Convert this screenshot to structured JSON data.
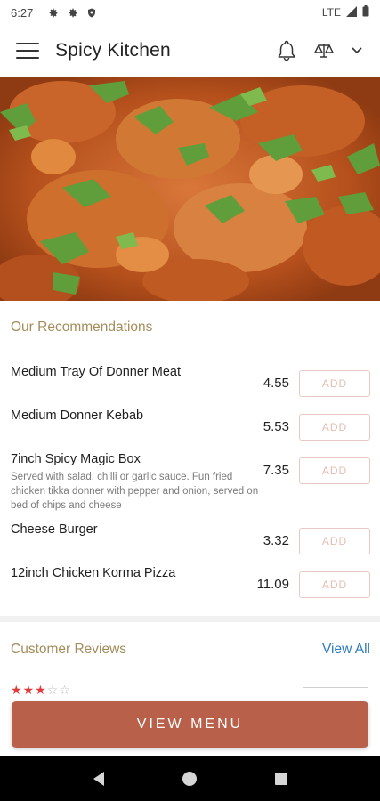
{
  "status_bar": {
    "time": "6:27",
    "network": "LTE",
    "left_icons": [
      "settings-icon",
      "settings-icon",
      "shield-icon"
    ],
    "right_icons": [
      "signal-icon",
      "battery-icon"
    ]
  },
  "app_bar": {
    "title": "Spicy Kitchen",
    "icons": [
      "menu-icon",
      "bell-icon",
      "scale-icon",
      "chevron-down-icon"
    ]
  },
  "recommendations": {
    "title": "Our Recommendations",
    "add_label": "ADD",
    "items": [
      {
        "name": "Medium Tray Of Donner Meat",
        "description": "",
        "price": "4.55"
      },
      {
        "name": "Medium Donner Kebab",
        "description": "",
        "price": "5.53"
      },
      {
        "name": "7inch Spicy Magic Box",
        "description": "Served with salad, chilli or garlic sauce. Fun fried chicken tikka donner with pepper and onion, served on  bed of chips and cheese",
        "price": "7.35"
      },
      {
        "name": "Cheese Burger",
        "description": "",
        "price": "3.32"
      },
      {
        "name": "12inch Chicken Korma Pizza",
        "description": "",
        "price": "11.09"
      }
    ]
  },
  "reviews": {
    "title": "Customer Reviews",
    "view_all": "View All",
    "first_rating": 3,
    "max_rating": 5
  },
  "cta": {
    "label": "VIEW MENU"
  },
  "nav_bar": {
    "icons": [
      "back-icon",
      "home-icon",
      "recents-icon"
    ]
  },
  "colors": {
    "accent": "#b9604b",
    "section_title": "#a38d5c",
    "link": "#2d7dbd",
    "star": "#e23a3a",
    "add_border": "#e8c9c1"
  }
}
